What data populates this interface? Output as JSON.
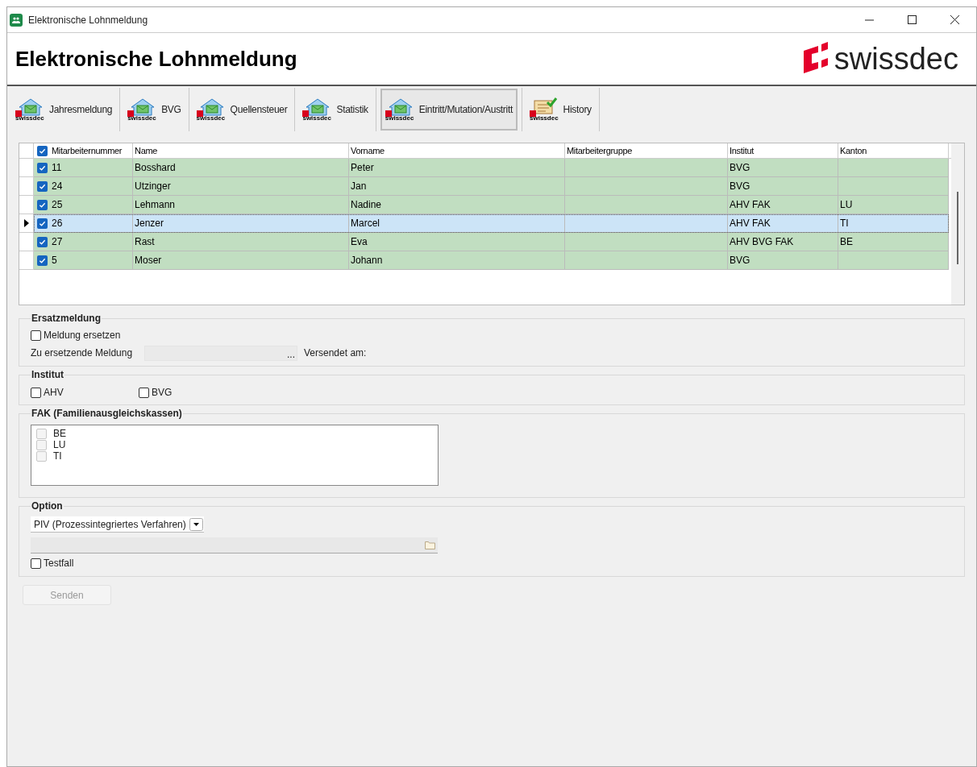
{
  "window": {
    "title": "Elektronische Lohnmeldung"
  },
  "header": {
    "title": "Elektronische Lohnmeldung",
    "logo_text": "swissdec"
  },
  "tabs": [
    {
      "label": "Jahresmeldung",
      "badge": "swissdec",
      "kind": "mail",
      "selected": false
    },
    {
      "label": "BVG",
      "badge": "swissdec",
      "kind": "mail",
      "selected": false
    },
    {
      "label": "Quellensteuer",
      "badge": "swissdec",
      "kind": "mail",
      "selected": false
    },
    {
      "label": "Statistik",
      "badge": "swissdec",
      "kind": "mail",
      "selected": false
    },
    {
      "label": "Eintritt/Mutation/Austritt",
      "badge": "swissdec",
      "kind": "mail",
      "selected": true
    },
    {
      "label": "History",
      "badge": "swissdec",
      "kind": "history",
      "selected": false
    }
  ],
  "table": {
    "all_checked": true,
    "columns": [
      "Mitarbeiternummer",
      "Name",
      "Vorname",
      "Mitarbeitergruppe",
      "Institut",
      "Kanton"
    ],
    "rows": [
      {
        "checked": true,
        "selected": false,
        "cells": [
          "11",
          "Bosshard",
          "Peter",
          "",
          "BVG",
          ""
        ]
      },
      {
        "checked": true,
        "selected": false,
        "cells": [
          "24",
          "Utzinger",
          "Jan",
          "",
          "BVG",
          ""
        ]
      },
      {
        "checked": true,
        "selected": false,
        "cells": [
          "25",
          "Lehmann",
          "Nadine",
          "",
          "AHV FAK",
          "LU"
        ]
      },
      {
        "checked": true,
        "selected": true,
        "cells": [
          "26",
          "Jenzer",
          "Marcel",
          "",
          "AHV FAK",
          "TI"
        ]
      },
      {
        "checked": true,
        "selected": false,
        "cells": [
          "27",
          "Rast",
          "Eva",
          "",
          "AHV BVG FAK",
          "BE"
        ]
      },
      {
        "checked": true,
        "selected": false,
        "cells": [
          "5",
          "Moser",
          "Johann",
          "",
          "BVG",
          ""
        ]
      }
    ]
  },
  "ersatzmeldung": {
    "title": "Ersatzmeldung",
    "replace": {
      "label": "Meldung ersetzen",
      "checked": false
    },
    "field_label": "Zu ersetzende Meldung",
    "field_disabled": true,
    "browse": "...",
    "sent_label": "Versendet am:"
  },
  "institut": {
    "title": "Institut",
    "options": [
      {
        "label": "AHV",
        "checked": false
      },
      {
        "label": "BVG",
        "checked": false
      }
    ]
  },
  "fak": {
    "title": "FAK (Familienausgleichskassen)",
    "items": [
      {
        "label": "BE",
        "checked": false
      },
      {
        "label": "LU",
        "checked": false
      },
      {
        "label": "TI",
        "checked": false
      }
    ]
  },
  "option": {
    "title": "Option",
    "select": "PIV (Prozessintegriertes Verfahren)",
    "testfall": {
      "label": "Testfall",
      "checked": false
    }
  },
  "send": {
    "label": "Senden",
    "disabled": true
  }
}
